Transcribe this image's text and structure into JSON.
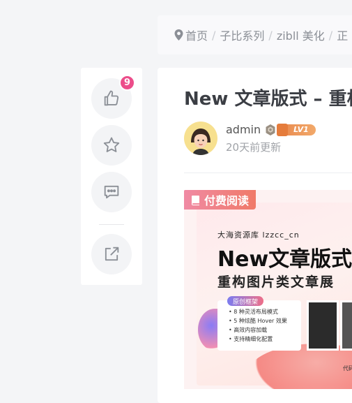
{
  "breadcrumb": {
    "items": [
      "首页",
      "子比系列",
      "zibll 美化",
      "正"
    ]
  },
  "actions": {
    "like_count": "9"
  },
  "article": {
    "title": "New 文章版式 – 重构",
    "author": "admin",
    "level": "LV1",
    "updated": "20天前更新",
    "paid_label": "付费阅读"
  },
  "cover": {
    "site": "大海资源库 lzzcc_cn",
    "headline": "New文章版式",
    "subheadline": "重构图片类文章展",
    "tag": "原创框架",
    "features": [
      "8 种灵活布局模式",
      "5 种炫酷 Hover 效果",
      "高效内容加载",
      "支持精细化配置"
    ],
    "footer_code": "代码"
  },
  "colors": {
    "badge": "#ec4d8a",
    "paid": "#f07a68",
    "level": "#e98a4f"
  }
}
